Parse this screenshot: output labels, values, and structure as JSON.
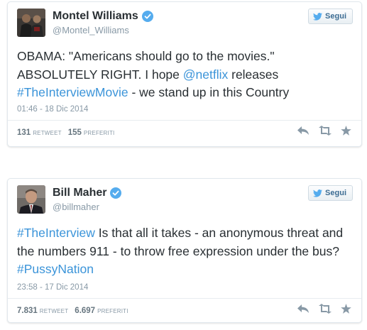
{
  "follow_label": "Segui",
  "colors": {
    "link": "#3b94d9",
    "verified": "#55acee",
    "meta": "#8899a6"
  },
  "tweets": [
    {
      "name": "Montel Williams",
      "handle": "@Montel_Williams",
      "text_part1": "OBAMA: \"Americans should go to the movies.\" ABSOLUTELY RIGHT. I hope ",
      "mention": "@netflix",
      "text_part2": " releases ",
      "hashtag": "#TheInterviewMovie",
      "text_part3": " - we stand up in this Country",
      "timestamp": "01:46 - 18 Dic 2014",
      "retweets": "131",
      "retweets_label": "RETWEET",
      "favorites": "155",
      "favorites_label": "PREFERITI"
    },
    {
      "name": "Bill Maher",
      "handle": "@billmaher",
      "hashtag1": "#TheInterview",
      "text_part1": " Is that all it takes - an anonymous threat and the numbers 911 - to throw free expression under the bus? ",
      "hashtag2": "#PussyNation",
      "timestamp": "23:58 - 17 Dic 2014",
      "retweets": "7.831",
      "retweets_label": "RETWEET",
      "favorites": "6.697",
      "favorites_label": "PREFERITI"
    }
  ]
}
